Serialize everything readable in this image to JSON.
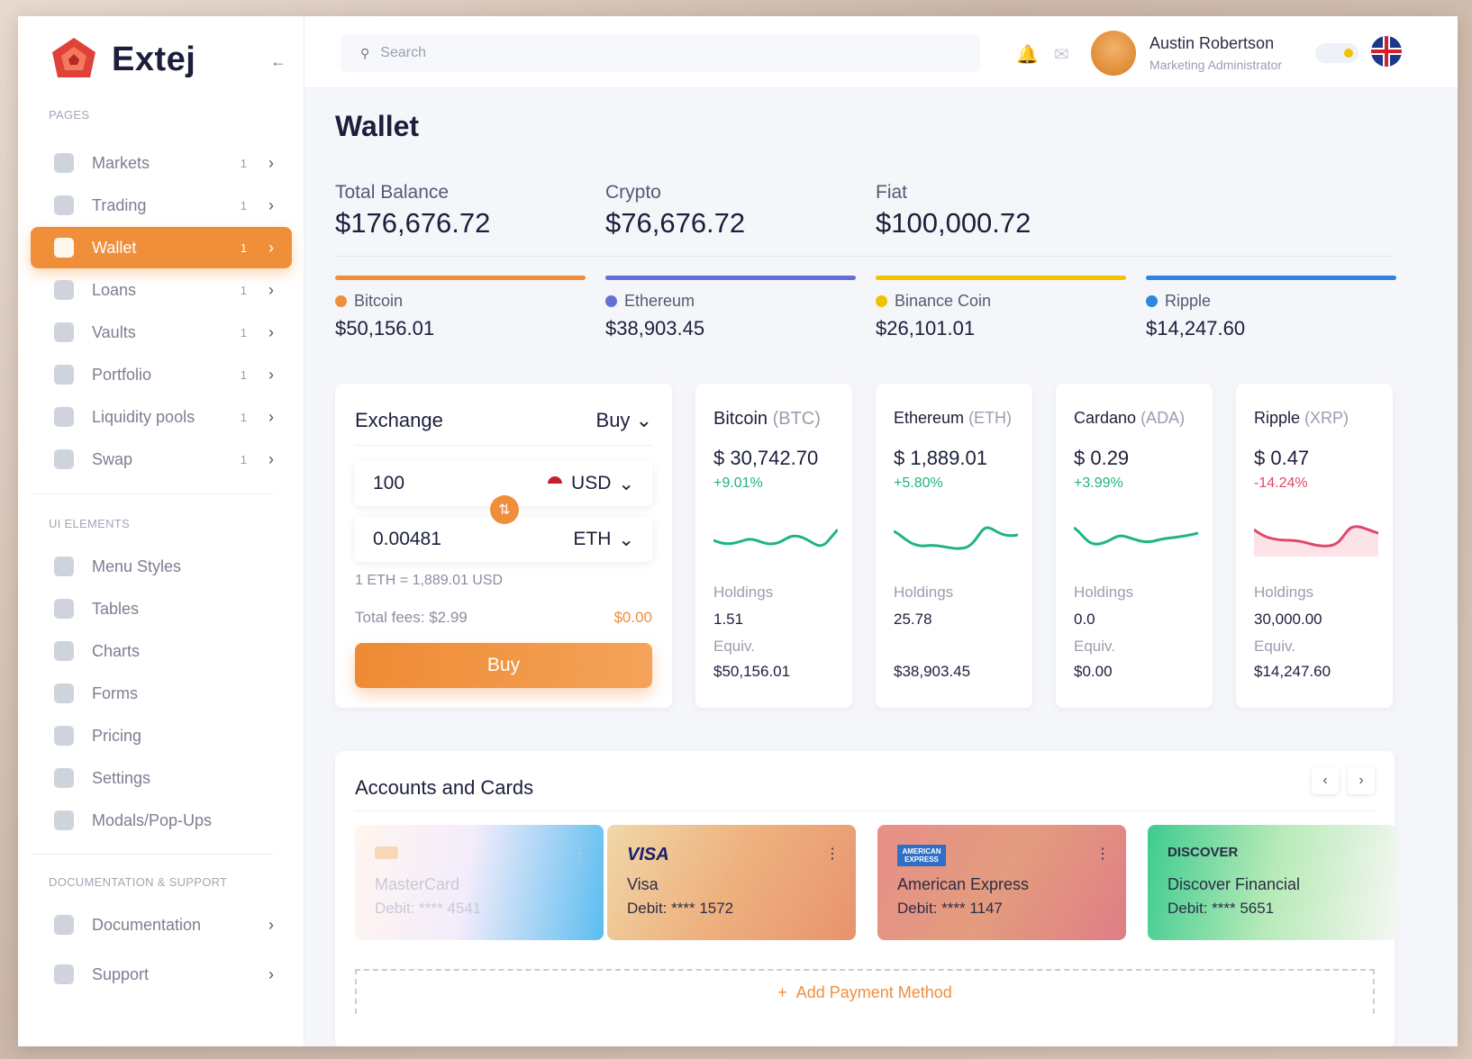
{
  "app": {
    "name": "Extej"
  },
  "header": {
    "search_placeholder": "Search",
    "user_name": "Austin Robertson",
    "user_role": "Marketing Administrator"
  },
  "sidebar": {
    "section_pages": "PAGES",
    "pages": [
      {
        "label": "Markets",
        "count": "1",
        "icon": "pie-chart-icon"
      },
      {
        "label": "Trading",
        "count": "1",
        "icon": "bar-chart-icon"
      },
      {
        "label": "Wallet",
        "count": "1",
        "icon": "wallet-icon",
        "active": true
      },
      {
        "label": "Loans",
        "count": "1",
        "icon": "loans-icon"
      },
      {
        "label": "Vaults",
        "count": "1",
        "icon": "shield-icon"
      },
      {
        "label": "Portfolio",
        "count": "1",
        "icon": "portfolio-icon"
      },
      {
        "label": "Liquidity pools",
        "count": "1",
        "icon": "liquidity-icon"
      },
      {
        "label": "Swap",
        "count": "1",
        "icon": "swap-icon"
      }
    ],
    "section_ui": "UI ELEMENTS",
    "ui": [
      {
        "label": "Menu Styles",
        "icon": "user-icon"
      },
      {
        "label": "Tables",
        "icon": "table-icon"
      },
      {
        "label": "Charts",
        "icon": "chart-icon"
      },
      {
        "label": "Forms",
        "icon": "form-icon"
      },
      {
        "label": "Pricing",
        "icon": "pricing-icon"
      },
      {
        "label": "Settings",
        "icon": "gear-icon"
      },
      {
        "label": "Modals/Pop-Ups",
        "icon": "modal-icon"
      }
    ],
    "section_docs": "DOCUMENTATION & SUPPORT",
    "docs": [
      {
        "label": "Documentation",
        "icon": "document-icon"
      },
      {
        "label": "Support",
        "icon": "support-icon"
      }
    ]
  },
  "page": {
    "title": "Wallet"
  },
  "balances": [
    {
      "label": "Total Balance",
      "value": "$176,676.72"
    },
    {
      "label": "Crypto",
      "value": "$76,676.72"
    },
    {
      "label": "Fiat",
      "value": "$100,000.72"
    }
  ],
  "coins": [
    {
      "name": "Bitcoin",
      "value": "$50,156.01",
      "color": "#f08f3a"
    },
    {
      "name": "Ethereum",
      "value": "$38,903.45",
      "color": "#6470d8"
    },
    {
      "name": "Binance Coin",
      "value": "$26,101.01",
      "color": "#f2c200"
    },
    {
      "name": "Ripple",
      "value": "$14,247.60",
      "color": "#2f86e0"
    }
  ],
  "exchange": {
    "title": "Exchange",
    "mode": "Buy",
    "amount": "100",
    "from_currency": "USD",
    "result": "0.00481",
    "to_currency": "ETH",
    "rate": "1 ETH = 1,889.01 USD",
    "fees_label": "Total fees: $2.99",
    "fees_value": "$0.00",
    "button": "Buy"
  },
  "markets": [
    {
      "name": "Bitcoin",
      "ticker": "(BTC)",
      "price": "$ 30,742.70",
      "change": "+9.01%",
      "up": true,
      "holdings_label": "Holdings",
      "holdings": "1.51",
      "equiv_label": "Equiv.",
      "equiv": "$50,156.01"
    },
    {
      "name": "Ethereum",
      "ticker": "(ETH)",
      "price": "$ 1,889.01",
      "change": "+5.80%",
      "up": true,
      "holdings_label": "Holdings",
      "holdings": "25.78",
      "equiv_label": "",
      "equiv": "$38,903.45"
    },
    {
      "name": "Cardano",
      "ticker": "(ADA)",
      "price": "$ 0.29",
      "change": "+3.99%",
      "up": true,
      "holdings_label": "Holdings",
      "holdings": "0.0",
      "equiv_label": "Equiv.",
      "equiv": "$0.00"
    },
    {
      "name": "Ripple",
      "ticker": "(XRP)",
      "price": "$ 0.47",
      "change": "-14.24%",
      "up": false,
      "holdings_label": "Holdings",
      "holdings": "30,000.00",
      "equiv_label": "Equiv.",
      "equiv": "$14,247.60"
    }
  ],
  "colors": {
    "accent": "#f08f3a",
    "up": "#1fb67a",
    "down": "#e0476a"
  },
  "accounts": {
    "title": "Accounts and Cards",
    "add_label": "Add Payment Method",
    "cards": [
      {
        "brand": "",
        "name": "MasterCard",
        "debit": "Debit: **** 4541"
      },
      {
        "brand": "VISA",
        "name": "Visa",
        "debit": "Debit: **** 1572"
      },
      {
        "brand": "AMERICAN EXPRESS",
        "name": "American Express",
        "debit": "Debit: **** 1147"
      },
      {
        "brand": "DISCOVER",
        "name": "Discover Financial",
        "debit": "Debit: **** 5651"
      }
    ]
  }
}
